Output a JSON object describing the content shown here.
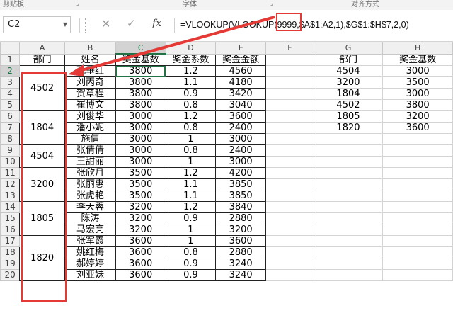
{
  "ribbon": {
    "groups": [
      "剪贴板",
      "字体",
      "对齐方式"
    ],
    "launcher_glyph": "⌟"
  },
  "formula_bar": {
    "name_box": "C2",
    "cancel_icon": "✕",
    "enter_icon": "✓",
    "fx_label": "fx",
    "formula": "=VLOOKUP(VLOOKUP(9999,$A$1:A2,1),$G$1:$H$7,2,0)",
    "highlight_color": "#e53935"
  },
  "sheet": {
    "columns": [
      "A",
      "B",
      "C",
      "D",
      "E",
      "F",
      "G",
      "H"
    ],
    "active_cell": "C2",
    "headers": [
      "部门",
      "姓名",
      "奖金基数",
      "奖金系数",
      "奖金金额",
      "",
      "部门",
      "奖金基数"
    ],
    "merged_dept": [
      {
        "value": "4502",
        "rows": 4
      },
      {
        "value": "1804",
        "rows": 3
      },
      {
        "value": "4504",
        "rows": 2
      },
      {
        "value": "3200",
        "rows": 3
      },
      {
        "value": "1805",
        "rows": 3
      },
      {
        "value": "1820",
        "rows": 4
      }
    ],
    "data_rows": [
      {
        "name": "孔垂红",
        "base": "3800",
        "coef": "1.2",
        "amount": "4560"
      },
      {
        "name": "刘丙奇",
        "base": "3800",
        "coef": "1.1",
        "amount": "4180"
      },
      {
        "name": "贺章程",
        "base": "3800",
        "coef": "0.9",
        "amount": "3420"
      },
      {
        "name": "崔博文",
        "base": "3800",
        "coef": "0.8",
        "amount": "3040"
      },
      {
        "name": "刘俊华",
        "base": "3000",
        "coef": "1.2",
        "amount": "3600"
      },
      {
        "name": "潘小妮",
        "base": "3000",
        "coef": "0.8",
        "amount": "2400"
      },
      {
        "name": "施倩",
        "base": "3000",
        "coef": "1",
        "amount": "3000"
      },
      {
        "name": "张倩倩",
        "base": "3000",
        "coef": "0.8",
        "amount": "2400"
      },
      {
        "name": "王甜丽",
        "base": "3000",
        "coef": "1",
        "amount": "3000"
      },
      {
        "name": "张欣月",
        "base": "3500",
        "coef": "1.2",
        "amount": "4200"
      },
      {
        "name": "张丽惠",
        "base": "3500",
        "coef": "1.1",
        "amount": "3850"
      },
      {
        "name": "张虎艳",
        "base": "3500",
        "coef": "1.1",
        "amount": "3850"
      },
      {
        "name": "李天蓉",
        "base": "3200",
        "coef": "1.2",
        "amount": "3840"
      },
      {
        "name": "陈涛",
        "base": "3200",
        "coef": "0.9",
        "amount": "2880"
      },
      {
        "name": "马宏亮",
        "base": "3200",
        "coef": "1",
        "amount": "3200"
      },
      {
        "name": "张军霞",
        "base": "3600",
        "coef": "1",
        "amount": "3600"
      },
      {
        "name": "姚红梅",
        "base": "3600",
        "coef": "0.8",
        "amount": "2880"
      },
      {
        "name": "郝婷婷",
        "base": "3600",
        "coef": "0.9",
        "amount": "3240"
      },
      {
        "name": "刘亚妹",
        "base": "3600",
        "coef": "0.9",
        "amount": "3240"
      }
    ],
    "lookup_table": [
      {
        "dept": "4504",
        "base": "3000"
      },
      {
        "dept": "3200",
        "base": "3500"
      },
      {
        "dept": "1804",
        "base": "3000"
      },
      {
        "dept": "4502",
        "base": "3800"
      },
      {
        "dept": "1805",
        "base": "3200"
      },
      {
        "dept": "1820",
        "base": "3600"
      }
    ],
    "annotation_color": "#e53935"
  }
}
